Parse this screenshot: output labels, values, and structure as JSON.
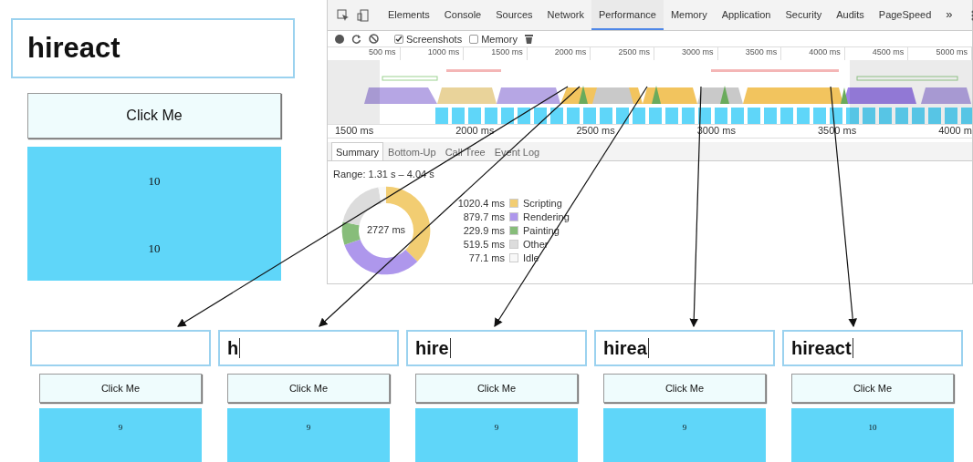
{
  "app": {
    "input_value": "hireact",
    "button": "Click Me",
    "box_texts": [
      "10",
      "10"
    ]
  },
  "devtools": {
    "tabs": [
      {
        "label": "Elements",
        "selected": false
      },
      {
        "label": "Console",
        "selected": false
      },
      {
        "label": "Sources",
        "selected": false
      },
      {
        "label": "Network",
        "selected": false
      },
      {
        "label": "Performance",
        "selected": true
      },
      {
        "label": "Memory",
        "selected": false
      },
      {
        "label": "Application",
        "selected": false
      },
      {
        "label": "Security",
        "selected": false
      },
      {
        "label": "Audits",
        "selected": false
      },
      {
        "label": "PageSpeed",
        "selected": false
      }
    ],
    "overflow": "»",
    "options": [
      {
        "label": "Screenshots",
        "checked": true
      },
      {
        "label": "Memory",
        "checked": false
      }
    ],
    "overview_ticks": [
      "500 ms",
      "1000 ms",
      "1500 ms",
      "2000 ms",
      "2500 ms",
      "3000 ms",
      "3500 ms",
      "4000 ms",
      "4500 ms",
      "5000 ms"
    ],
    "ruler_ticks": [
      "1500 ms",
      "2000 ms",
      "2500 ms",
      "3000 ms",
      "3500 ms",
      "4000 m"
    ],
    "summary_tabs": [
      {
        "label": "Summary",
        "selected": true
      },
      {
        "label": "Bottom-Up",
        "selected": false
      },
      {
        "label": "Call Tree",
        "selected": false
      },
      {
        "label": "Event Log",
        "selected": false
      }
    ],
    "range": "Range: 1.31 s – 4.04 s",
    "total": "2727 ms",
    "legend": [
      {
        "value": "1020.4 ms",
        "label": "Scripting",
        "color": "#f2cd72"
      },
      {
        "value": "879.7 ms",
        "label": "Rendering",
        "color": "#ae97ec"
      },
      {
        "value": "229.9 ms",
        "label": "Painting",
        "color": "#87bd7a"
      },
      {
        "value": "519.5 ms",
        "label": "Other",
        "color": "#dcdcdc"
      },
      {
        "value": "77.1 ms",
        "label": "Idle",
        "color": "#f8f8f8"
      }
    ],
    "chart_data": {
      "type": "donut",
      "values": [
        37.43,
        32.26,
        8.43,
        19.05,
        2.83
      ]
    }
  },
  "frames": [
    {
      "button": "Click Me",
      "count": "9"
    },
    {
      "input_value": "h",
      "button": "Click Me",
      "count": "9"
    },
    {
      "input_value": "hire",
      "button": "Click Me",
      "count": "9"
    },
    {
      "input_value": "hirea",
      "button": "Click Me",
      "count": "9"
    },
    {
      "input_value": "hireact",
      "button": "Click Me",
      "count": "10"
    }
  ]
}
